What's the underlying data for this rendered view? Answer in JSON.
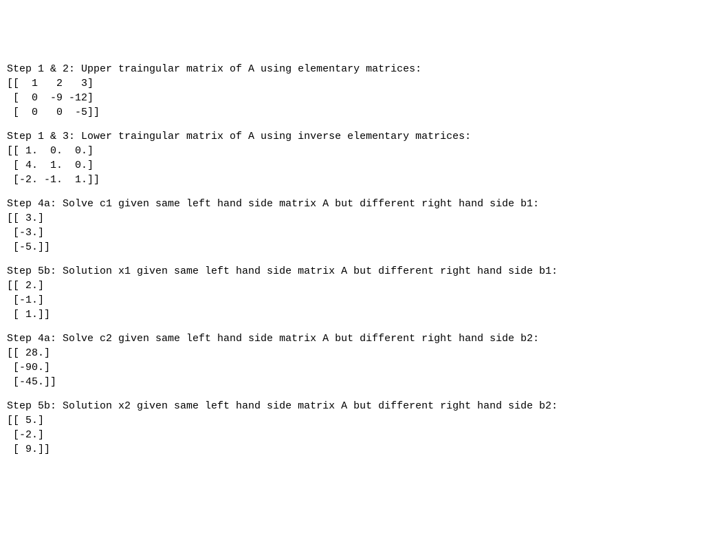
{
  "sections": [
    {
      "heading": "Step 1 & 2: Upper traingular matrix of A using elementary matrices:",
      "matrix": "[[  1   2   3]\n [  0  -9 -12]\n [  0   0  -5]]"
    },
    {
      "heading": "Step 1 & 3: Lower traingular matrix of A using inverse elementary matrices:",
      "matrix": "[[ 1.  0.  0.]\n [ 4.  1.  0.]\n [-2. -1.  1.]]"
    },
    {
      "heading": "Step 4a: Solve c1 given same left hand side matrix A but different right hand side b1:",
      "matrix": "[[ 3.]\n [-3.]\n [-5.]]"
    },
    {
      "heading": "Step 5b: Solution x1 given same left hand side matrix A but different right hand side b1:",
      "matrix": "[[ 2.]\n [-1.]\n [ 1.]]"
    },
    {
      "heading": "Step 4a: Solve c2 given same left hand side matrix A but different right hand side b2:",
      "matrix": "[[ 28.]\n [-90.]\n [-45.]]"
    },
    {
      "heading": "Step 5b: Solution x2 given same left hand side matrix A but different right hand side b2:",
      "matrix": "[[ 5.]\n [-2.]\n [ 9.]]"
    }
  ]
}
